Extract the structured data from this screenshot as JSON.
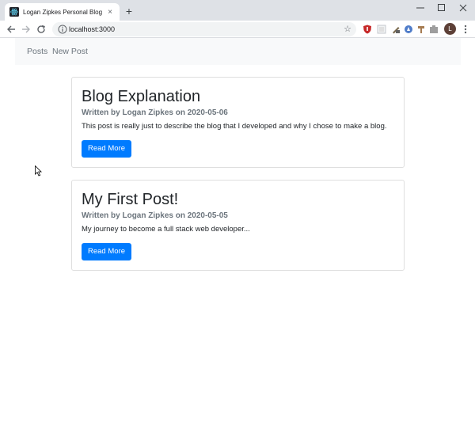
{
  "browser": {
    "tab_title": "Logan Zipkes Personal Blog",
    "tab_close": "×",
    "new_tab": "+",
    "url": "localhost:3000",
    "star": "☆",
    "profile_initial": "L"
  },
  "colors": {
    "primary": "#007bff",
    "navbar_bg": "#f8f9fa",
    "muted": "#6c757d",
    "profile": "#5d4037"
  },
  "navbar": {
    "links": [
      "Posts",
      "New Post"
    ]
  },
  "posts": [
    {
      "title": "Blog Explanation",
      "byline": "Written by Logan Zipkes on 2020-05-06",
      "summary": "This post is really just to describe the blog that I developed and why I chose to make a blog.",
      "button": "Read More"
    },
    {
      "title": "My First Post!",
      "byline": "Written by Logan Zipkes on 2020-05-05",
      "summary": "My journey to become a full stack web developer...",
      "button": "Read More"
    }
  ]
}
